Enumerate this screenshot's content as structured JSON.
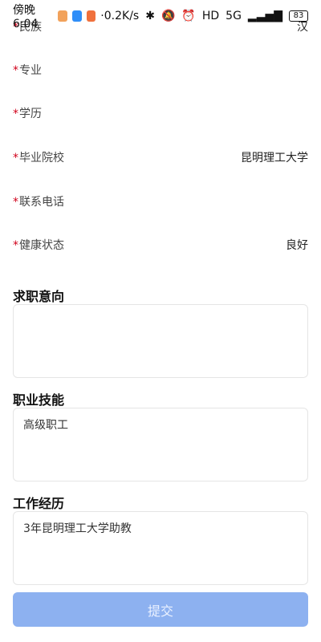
{
  "status_bar": {
    "time": "傍晚6:04",
    "speed": "0.2K/s",
    "battery": "83",
    "network": "5G"
  },
  "form": {
    "rows": [
      {
        "label": "民族",
        "value": "汉",
        "required": true
      },
      {
        "label": "专业",
        "value": "",
        "required": true
      },
      {
        "label": "学历",
        "value": "",
        "required": true
      },
      {
        "label": "毕业院校",
        "value": "昆明理工大学",
        "required": true
      },
      {
        "label": "联系电话",
        "value": "",
        "required": true
      },
      {
        "label": "健康状态",
        "value": "良好",
        "required": true
      }
    ],
    "sections": [
      {
        "title": "求职意向",
        "value": ""
      },
      {
        "title": "职业技能",
        "value": "高级职工"
      },
      {
        "title": "工作经历",
        "value": "3年昆明理工大学助教"
      }
    ],
    "submit_label": "提交"
  },
  "colors": {
    "required_star": "#d0021b",
    "submit_bg": "#8db1f0"
  }
}
